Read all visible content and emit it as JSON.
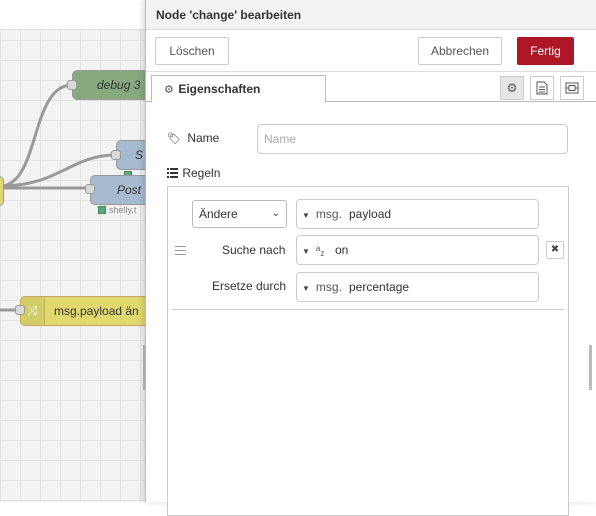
{
  "workspace": {
    "nodes": {
      "debug": "debug 3",
      "set": "S",
      "post": "Post",
      "status_shelly": "shelly.t",
      "change": "msg.payload än"
    }
  },
  "tray": {
    "title": "Node 'change' bearbeiten",
    "buttons": {
      "delete": "Löschen",
      "cancel": "Abbrechen",
      "done": "Fertig"
    },
    "tab": {
      "label": "Eigenschaften"
    },
    "name": {
      "label": "Name",
      "placeholder": "Name"
    },
    "rules": {
      "label": "Regeln",
      "action": "Ändere",
      "target": {
        "prefix": "msg.",
        "value": "payload"
      },
      "search": {
        "label": "Suche nach",
        "type_icon": "az",
        "value": "on"
      },
      "replace": {
        "label": "Ersetze durch",
        "prefix": "msg.",
        "value": "percentage"
      }
    }
  },
  "colors": {
    "primary": "#ad1625",
    "node_green": "#87a980",
    "node_blue": "#a6bbcf",
    "node_yellow": "#e2d96e"
  },
  "icons": [
    "gear-icon",
    "document-icon",
    "layout-icon",
    "tag-icon",
    "list-icon",
    "drag-handle-icon",
    "remove-icon",
    "shuffle-icon"
  ]
}
